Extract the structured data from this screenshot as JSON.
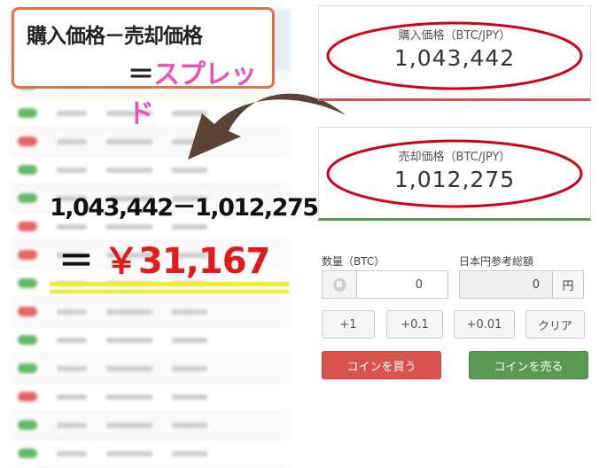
{
  "annotation": {
    "title": "購入価格－売却価格",
    "equals": "＝",
    "spread_label": "スプレッド",
    "calculation": "1,043,442－1,012,275",
    "result_equals": "＝",
    "result_value": "￥31,167"
  },
  "buy_panel": {
    "label": "購入価格（BTC/JPY）",
    "value": "1,043,442"
  },
  "sell_panel": {
    "label": "売却価格（BTC/JPY）",
    "value": "1,012,275"
  },
  "form": {
    "quantity_label": "数量（BTC）",
    "quantity_value": "0",
    "coin_icon": "B",
    "jpy_label": "日本円参考総額",
    "jpy_value": "0",
    "jpy_unit": "円"
  },
  "increments": [
    "+1",
    "+0.1",
    "+0.01",
    "クリア"
  ],
  "actions": {
    "buy": "コインを買う",
    "sell": "コインを売る"
  },
  "colors": {
    "accent_red": "#e01b1b",
    "spread_pink": "#e754b4",
    "buy_button": "#d9534f",
    "sell_button": "#5b9a52",
    "ellipse": "#d0021b"
  },
  "list_rows": [
    "green",
    "green",
    "red",
    "green",
    "green",
    "red",
    "red",
    "green",
    "red",
    "green",
    "green",
    "red",
    "green",
    "green"
  ]
}
